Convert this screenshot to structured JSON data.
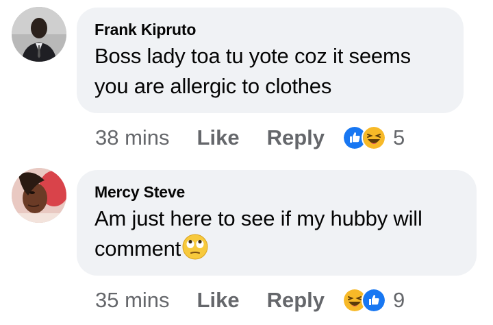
{
  "comments": [
    {
      "author": "Frank Kipruto",
      "text": "Boss lady toa tu yote coz it seems you are allergic to clothes",
      "text_line1": "Boss lady toa tu yote coz it seems",
      "text_line2": "you are allergic to clothes",
      "time": "38 mins",
      "like_label": "Like",
      "reply_label": "Reply",
      "reaction_icons": [
        "like-icon",
        "laughing-icon"
      ],
      "reaction_count": "5"
    },
    {
      "author": "Mercy Steve",
      "text_line1": "Am just here to see if my hubby will",
      "text_line2": "comment",
      "inline_emoji": "eye-roll-emoji",
      "time": "35 mins",
      "like_label": "Like",
      "reply_label": "Reply",
      "reaction_icons": [
        "laughing-icon",
        "like-icon"
      ],
      "reaction_count": "9"
    }
  ],
  "colors": {
    "bubble": "#f0f2f5",
    "secondary_text": "#65676b",
    "like_blue": "#1877f2",
    "emoji_yellow": "#f7b928"
  }
}
